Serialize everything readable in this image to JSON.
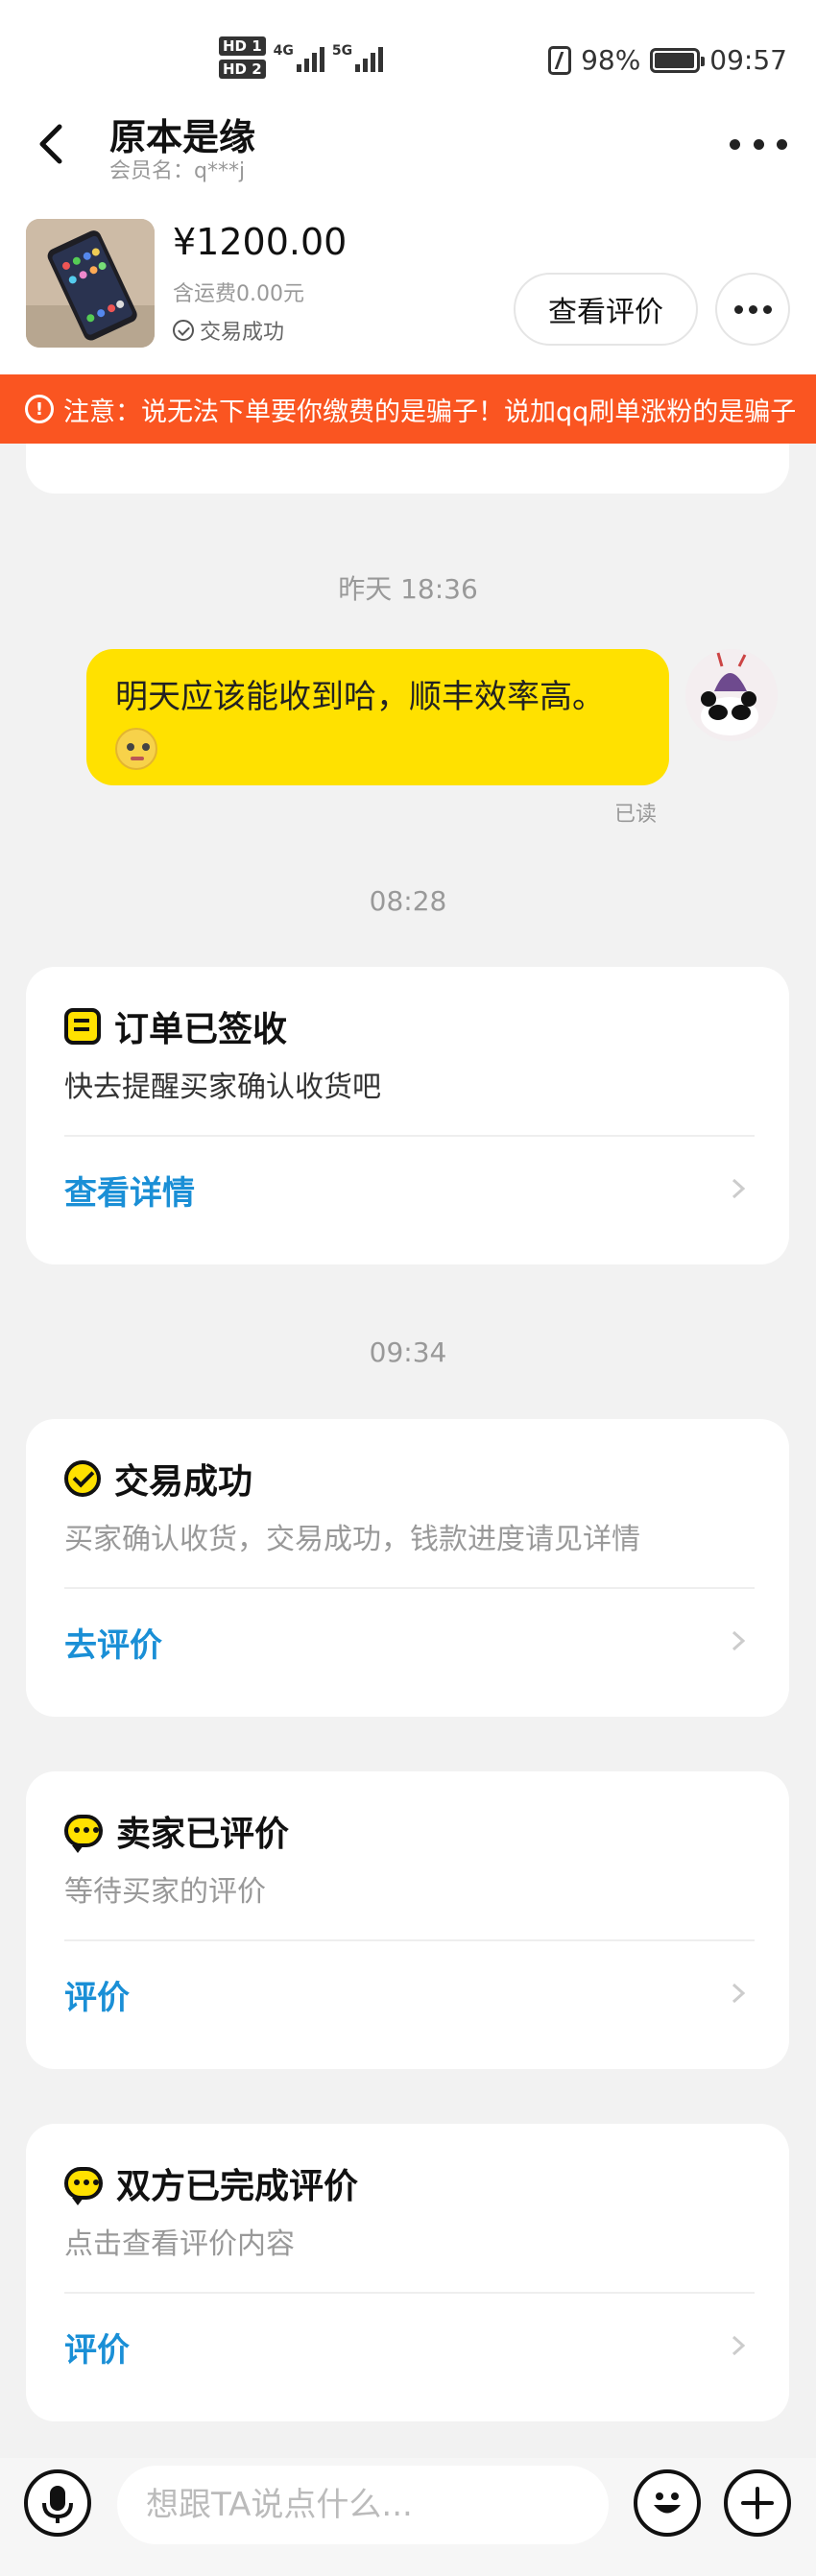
{
  "status_bar": {
    "hd1": "HD 1",
    "hd2": "HD 2",
    "net1": "4G",
    "net2": "5G",
    "battery": "98%",
    "time": "09:57"
  },
  "header": {
    "title": "原本是缘",
    "subtitle": "会员名：q***j"
  },
  "product": {
    "price": "¥1200.00",
    "shipping": "含运费0.00元",
    "status": "交易成功",
    "review_label": "查看评价"
  },
  "warning": {
    "text": "注意：说无法下单要你缴费的是骗子！说加qq刷单涨粉的是骗子"
  },
  "chat": {
    "timestamps": [
      "昨天 18:36",
      "08:28",
      "09:34"
    ],
    "message": "明天应该能收到哈，顺丰效率高。",
    "read_label": "已读"
  },
  "cards": [
    {
      "title": "订单已签收",
      "desc": "快去提醒买家确认收货吧",
      "link": "查看详情"
    },
    {
      "title": "交易成功",
      "desc": "买家确认收货，交易成功，钱款进度请见详情",
      "link": "去评价"
    },
    {
      "title": "卖家已评价",
      "desc": "等待买家的评价",
      "link": "评价"
    },
    {
      "title": "双方已完成评价",
      "desc": "点击查看评价内容",
      "link": "评价"
    }
  ],
  "input": {
    "placeholder": "想跟TA说点什么..."
  },
  "colors": {
    "accent_yellow": "#ffe100",
    "warning_orange": "#fa5521",
    "link_blue": "#1a8fd6"
  }
}
